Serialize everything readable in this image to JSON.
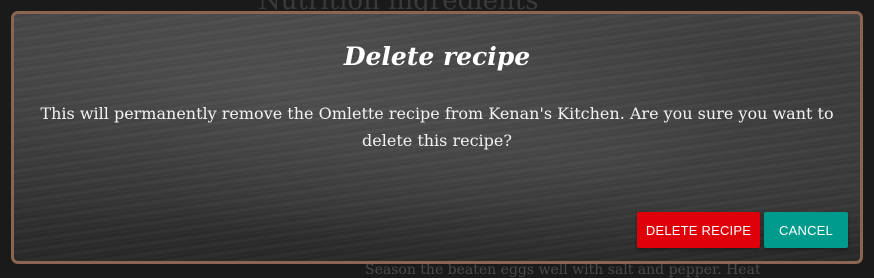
{
  "background": {
    "top_text": "Nutrition ingredients",
    "bottom_text": "Season the beaten eggs well with salt and pepper. Heat"
  },
  "modal": {
    "title": "Delete recipe",
    "message": "This will permanently remove the Omlette recipe from Kenan's Kitchen. Are you sure you want to delete this recipe?",
    "delete_label": "DELETE RECIPE",
    "cancel_label": "CANCEL"
  },
  "colors": {
    "border": "#8a6652",
    "delete_button": "#e0000a",
    "cancel_button": "#009b8c",
    "chalkboard": "#363636"
  }
}
